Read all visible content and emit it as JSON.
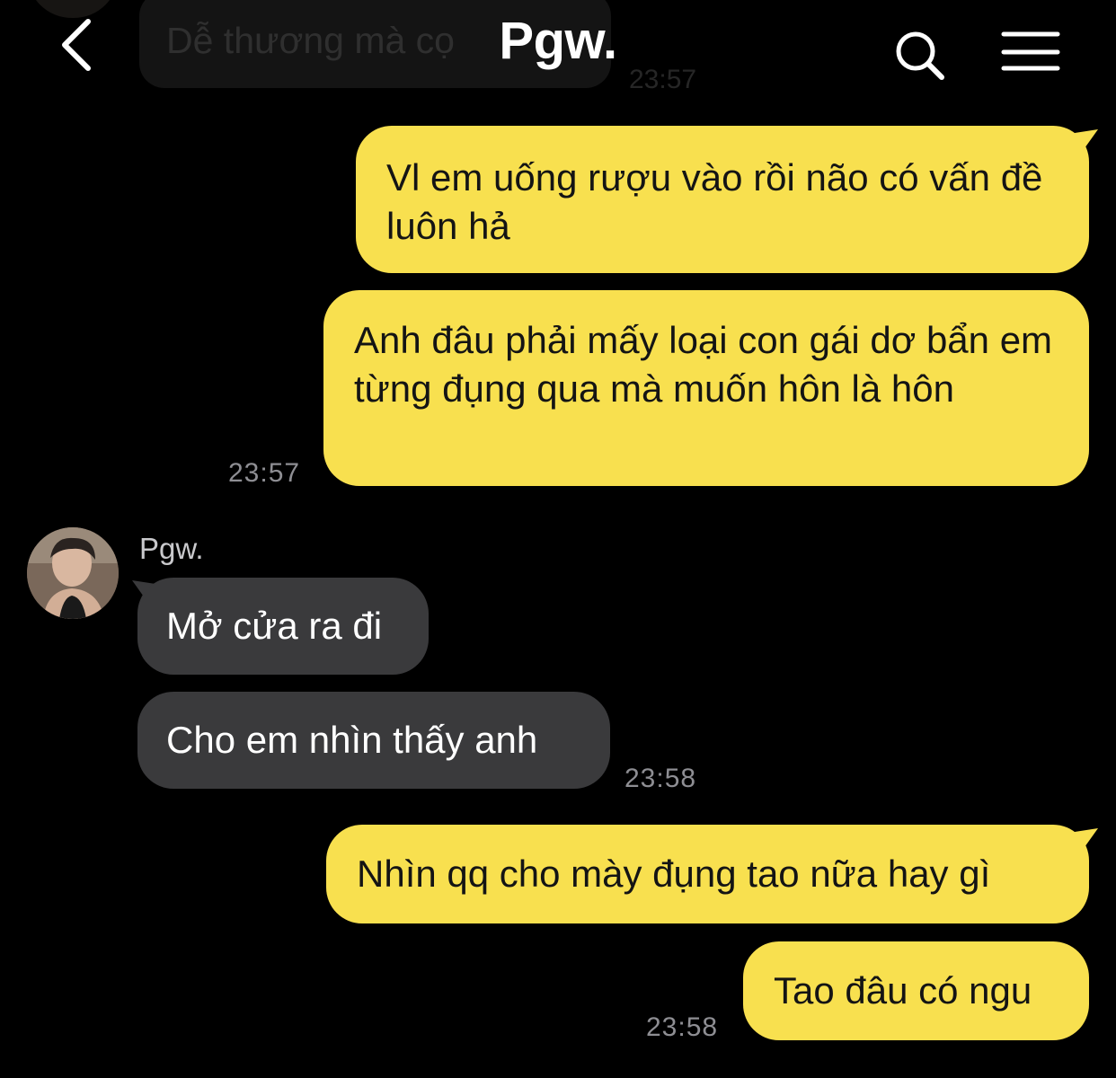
{
  "header": {
    "title": "Pgw.",
    "back_icon": "chevron-left-icon",
    "search_icon": "search-icon",
    "menu_icon": "hamburger-menu-icon"
  },
  "faded_message": {
    "text": "Dễ thương mà cọ",
    "time": "23:57"
  },
  "messages": [
    {
      "from": "me",
      "text": "Vl em uống rượu vào rồi não có vấn đề luôn hả"
    },
    {
      "from": "me",
      "text": "Anh đâu phải mấy loại con gái dơ bẩn em từng đụng qua mà muốn hôn là hôn",
      "time": "23:57"
    },
    {
      "from": "them",
      "sender": "Pgw.",
      "text": "Mở cửa ra đi"
    },
    {
      "from": "them",
      "text": "Cho em nhìn thấy anh",
      "time": "23:58"
    },
    {
      "from": "me",
      "text": "Nhìn qq cho mày đụng tao nữa hay gì"
    },
    {
      "from": "me",
      "text": "Tao đâu có ngu",
      "time": "23:58"
    }
  ],
  "colors": {
    "background": "#000000",
    "my_bubble": "#f8e04f",
    "their_bubble": "#3a3a3c",
    "timestamp": "#8e8e93"
  }
}
